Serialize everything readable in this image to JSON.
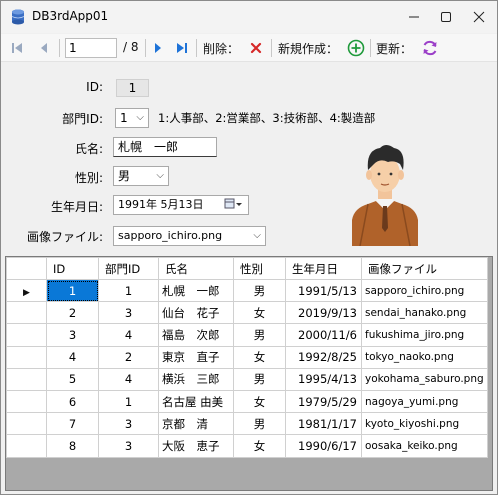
{
  "window": {
    "title": "DB3rdApp01"
  },
  "toolbar": {
    "position": "1",
    "count_label": "/ 8",
    "delete_label": "削除：",
    "new_label": "新規作成：",
    "update_label": "更新："
  },
  "form": {
    "id_label": "ID:",
    "id_value": "1",
    "dept_label": "部門ID:",
    "dept_value": "1",
    "dept_legend": "1:人事部、2:営業部、3:技術部、4:製造部",
    "name_label": "氏名:",
    "name_value": "札幌　一郎",
    "gender_label": "性別:",
    "gender_value": "男",
    "birth_label": "生年月日:",
    "birth_value": "1991年  5月13日",
    "image_label": "画像ファイル:",
    "image_value": "sapporo_ichiro.png"
  },
  "grid": {
    "columns": [
      "ID",
      "部門ID",
      "氏名",
      "性別",
      "生年月日",
      "画像ファイル"
    ],
    "rows": [
      [
        "1",
        "1",
        "札幌　一郎",
        "男",
        "1991/5/13",
        "sapporo_ichiro.png"
      ],
      [
        "2",
        "3",
        "仙台　花子",
        "女",
        "2019/9/13",
        "sendai_hanako.png"
      ],
      [
        "3",
        "4",
        "福島　次郎",
        "男",
        "2000/11/6",
        "fukushima_jiro.png"
      ],
      [
        "4",
        "2",
        "東京　直子",
        "女",
        "1992/8/25",
        "tokyo_naoko.png"
      ],
      [
        "5",
        "4",
        "横浜　三郎",
        "男",
        "1995/4/13",
        "yokohama_saburo.png"
      ],
      [
        "6",
        "1",
        "名古屋 由美",
        "女",
        "1979/5/29",
        "nagoya_yumi.png"
      ],
      [
        "7",
        "3",
        "京都　清",
        "男",
        "1981/1/17",
        "kyoto_kiyoshi.png"
      ],
      [
        "8",
        "3",
        "大阪　恵子",
        "女",
        "1990/6/17",
        "oosaka_keiko.png"
      ]
    ],
    "selected_row": 0
  },
  "colors": {
    "nav_blue": "#1e73d8",
    "delete_red": "#d62828",
    "add_green": "#1f9a3b",
    "refresh_purple": "#9b3fc8",
    "selection": "#0a78d7"
  }
}
